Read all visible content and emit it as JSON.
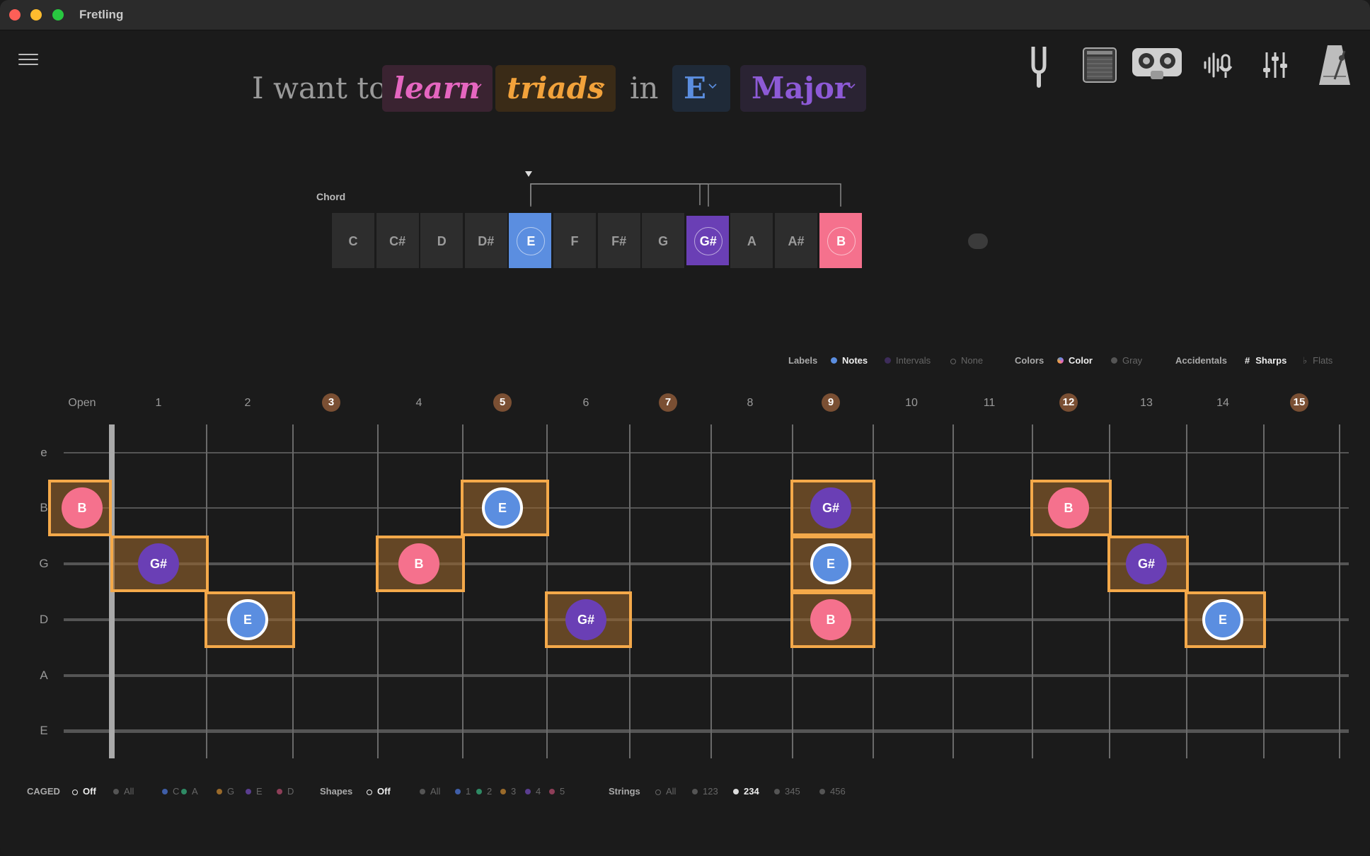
{
  "window": {
    "title": "Fretling"
  },
  "sentence": {
    "prefix": "I want to",
    "mode": "learn",
    "topic": "triads",
    "connector": "in",
    "key": "E",
    "scale": "Major",
    "colors": {
      "mode": "#e566c0",
      "topic": "#f2a23b",
      "key": "#5b8ee0",
      "scale": "#8d5ad6"
    }
  },
  "tools": [
    "tuning-fork-icon",
    "amplifier-icon",
    "cassette-icon",
    "voice-mic-icon",
    "mixer-sliders-icon",
    "metronome-icon"
  ],
  "chord": {
    "label": "Chord",
    "notes": [
      "C",
      "C#",
      "D",
      "D#",
      "E",
      "F",
      "F#",
      "G",
      "G#",
      "A",
      "A#",
      "B"
    ],
    "root": "E",
    "third": "G#",
    "fifth": "B"
  },
  "options": {
    "labels": {
      "title": "Labels",
      "items": [
        "Notes",
        "Intervals",
        "None"
      ],
      "active": "Notes"
    },
    "colors": {
      "title": "Colors",
      "items": [
        "Color",
        "Gray"
      ],
      "active": "Color"
    },
    "accidentals": {
      "title": "Accidentals",
      "items": [
        "Sharps",
        "Flats"
      ],
      "symbols": [
        "#",
        "♭"
      ],
      "active": "Sharps"
    }
  },
  "fretboard": {
    "fret_numbers": [
      "Open",
      "1",
      "2",
      "3",
      "4",
      "5",
      "6",
      "7",
      "8",
      "9",
      "10",
      "11",
      "12",
      "13",
      "14",
      "15"
    ],
    "marker_frets": [
      "3",
      "5",
      "7",
      "9",
      "12",
      "15"
    ],
    "strings": [
      "e",
      "B",
      "G",
      "D",
      "A",
      "E"
    ],
    "notes": [
      {
        "string": 1,
        "fret": 0,
        "note": "B",
        "role": "fifth"
      },
      {
        "string": 2,
        "fret": 1,
        "note": "G#",
        "role": "third"
      },
      {
        "string": 3,
        "fret": 2,
        "note": "E",
        "role": "root"
      },
      {
        "string": 2,
        "fret": 4,
        "note": "B",
        "role": "fifth"
      },
      {
        "string": 1,
        "fret": 5,
        "note": "E",
        "role": "root"
      },
      {
        "string": 3,
        "fret": 6,
        "note": "G#",
        "role": "third"
      },
      {
        "string": 1,
        "fret": 9,
        "note": "G#",
        "role": "third"
      },
      {
        "string": 2,
        "fret": 9,
        "note": "E",
        "role": "root"
      },
      {
        "string": 3,
        "fret": 9,
        "note": "B",
        "role": "fifth"
      },
      {
        "string": 1,
        "fret": 12,
        "note": "B",
        "role": "fifth"
      },
      {
        "string": 2,
        "fret": 13,
        "note": "G#",
        "role": "third"
      },
      {
        "string": 3,
        "fret": 14,
        "note": "E",
        "role": "root"
      }
    ],
    "role_colors": {
      "root": "#5b8ee0",
      "third": "#6a3fb5",
      "fifth": "#f5718d"
    }
  },
  "bottom": {
    "caged": {
      "title": "CAGED",
      "items": [
        "Off",
        "All",
        "C",
        "A",
        "G",
        "E",
        "D"
      ],
      "active": "Off",
      "colors": [
        "",
        "#555",
        "#3f5ea8",
        "#2e8a64",
        "#9a6a2a",
        "#5a3d8f",
        "#8e3e58"
      ]
    },
    "shapes": {
      "title": "Shapes",
      "items": [
        "Off",
        "All",
        "1",
        "2",
        "3",
        "4",
        "5"
      ],
      "active": "Off",
      "colors": [
        "",
        "#555",
        "#3f5ea8",
        "#2e8a64",
        "#9a6a2a",
        "#5a3d8f",
        "#8e3e58"
      ]
    },
    "strings": {
      "title": "Strings",
      "items": [
        "All",
        "123",
        "234",
        "345",
        "456"
      ],
      "active": "234"
    }
  }
}
